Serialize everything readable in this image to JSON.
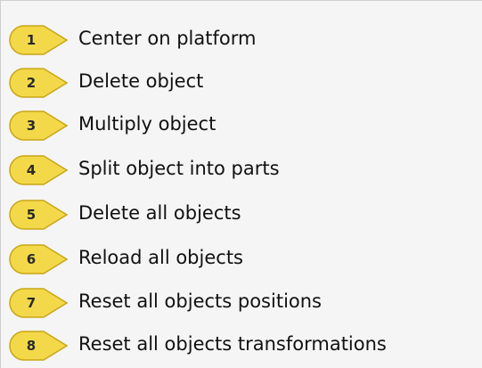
{
  "colors": {
    "menu_background": "#f5f5f5",
    "callout_fill": "#f3d94a",
    "callout_stroke": "#c9a616",
    "text": "#111111"
  },
  "menu": {
    "items": [
      {
        "number": "1",
        "label": "Center on platform"
      },
      {
        "number": "2",
        "label": "Delete object"
      },
      {
        "number": "3",
        "label": "Multiply object"
      },
      {
        "number": "4",
        "label": "Split object into parts"
      },
      {
        "number": "5",
        "label": "Delete all objects"
      },
      {
        "number": "6",
        "label": "Reload all objects"
      },
      {
        "number": "7",
        "label": "Reset all objects positions"
      },
      {
        "number": "8",
        "label": "Reset all objects transformations"
      }
    ]
  }
}
